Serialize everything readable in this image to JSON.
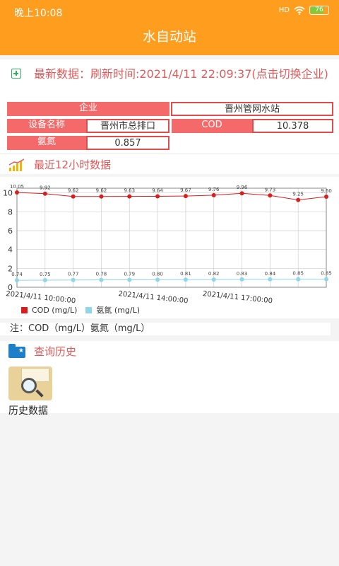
{
  "status_bar": {
    "time": "晚上10:08",
    "signal": "HD",
    "battery": "76",
    "battery_level": 0.76
  },
  "app_bar": {
    "title": "水自动站"
  },
  "latest": {
    "header": "最新数据：刷新时间:2021/4/11 22:09:37(点击切换企业)",
    "enterprise_label": "企业",
    "enterprise_value": "晋州管网水站",
    "device_label": "设备名称",
    "device_value": "晋州市总排口",
    "cod_label": "COD",
    "cod_value": "10.378",
    "nh3_label": "氨氮",
    "nh3_value": "0.857"
  },
  "recent": {
    "title": "最近12小时数据"
  },
  "chart_data": {
    "type": "line",
    "x": [
      "2021/4/11 10:00:00",
      "",
      "",
      "",
      "2021/4/11 14:00:00",
      "",
      "",
      "2021/4/11 17:00:00",
      "",
      "",
      "",
      ""
    ],
    "x_ticks": [
      "2021/4/11 10:00:00",
      "2021/4/11 14:00:00",
      "2021/4/11 17:00:00"
    ],
    "series": [
      {
        "name": "COD (mg/L)",
        "color": "#d81e1e",
        "values": [
          10.05,
          9.92,
          9.62,
          9.62,
          9.63,
          9.64,
          9.67,
          9.76,
          9.96,
          9.73,
          9.25,
          9.6
        ]
      },
      {
        "name": "氨氮 (mg/L)",
        "color": "#8fd6ea",
        "values": [
          0.74,
          0.75,
          0.77,
          0.78,
          0.79,
          0.8,
          0.81,
          0.82,
          0.83,
          0.84,
          0.85,
          0.85
        ]
      }
    ],
    "y_ticks": [
      0,
      2,
      4,
      6,
      8,
      10
    ],
    "ylim": [
      0,
      10.5
    ],
    "grid": true,
    "legend_position": "bottom-left"
  },
  "note": {
    "text": "注：COD（mg/L）氨氮（mg/L）"
  },
  "history": {
    "title": "查询历史",
    "tile_label": "历史数据"
  }
}
